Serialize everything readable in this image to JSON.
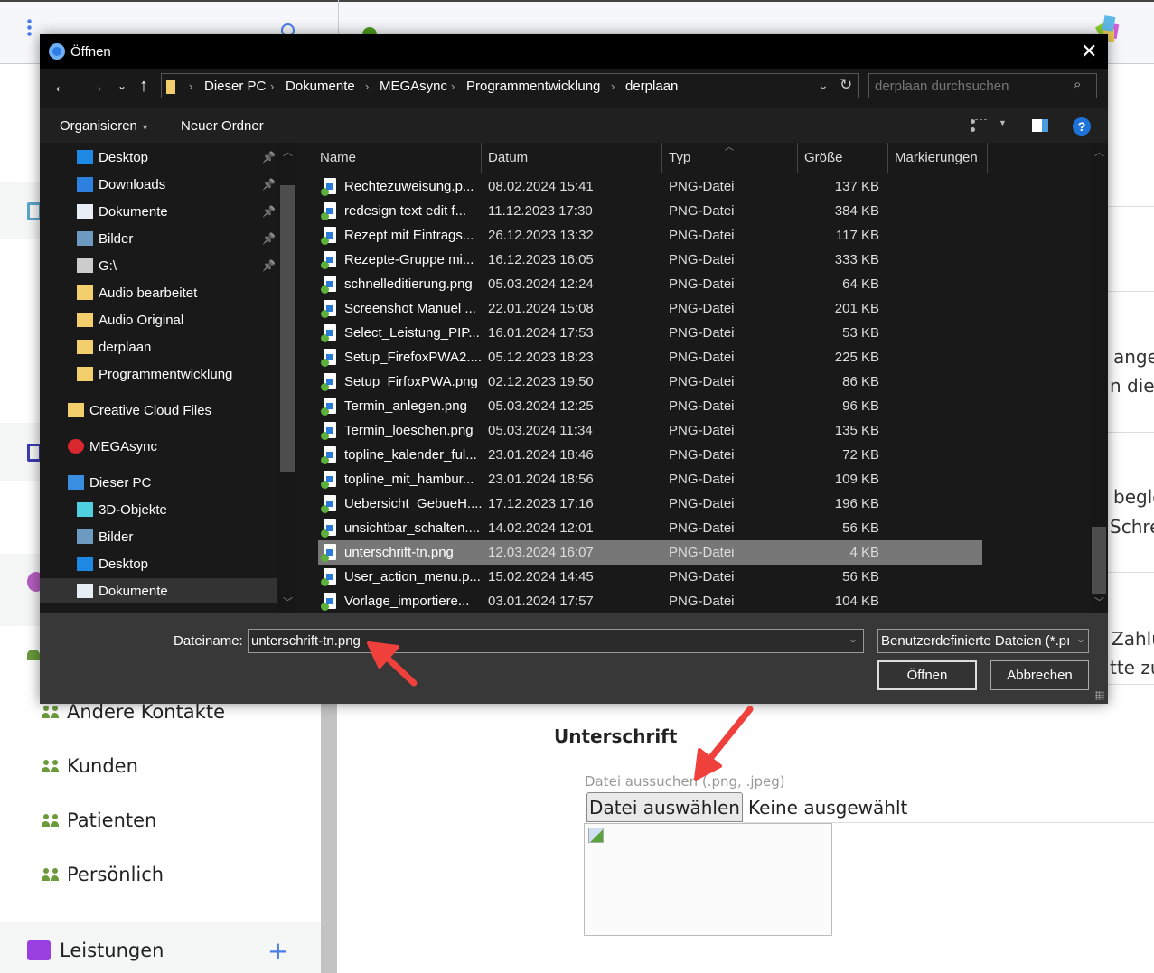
{
  "background": {
    "sidebar": {
      "groups": [
        "Andere Kontakte",
        "Kunden",
        "Patienten",
        "Persönlich"
      ],
      "section": {
        "label": "Leistungen",
        "add_icon": "plus-icon"
      }
    },
    "content": {
      "right_snippets": [
        "ange",
        "n dies",
        "begle",
        "Schre",
        "Zahlu",
        "tte zu"
      ],
      "signature": {
        "heading": "Unterschrift",
        "file_label": "Datei aussuchen (.png, .jpeg)",
        "choose_button": "Datei auswählen",
        "no_file": "Keine ausgewählt"
      }
    }
  },
  "dialog": {
    "title": "Öffnen",
    "breadcrumb": [
      "Dieser PC",
      "Dokumente",
      "MEGAsync",
      "Programmentwicklung",
      "derplaan"
    ],
    "search_placeholder": "derplaan durchsuchen",
    "toolbar": {
      "organize": "Organisieren",
      "new_folder": "Neuer Ordner"
    },
    "nav": [
      {
        "label": "Desktop",
        "icon": "desktop-icon",
        "pinned": true
      },
      {
        "label": "Downloads",
        "icon": "download-icon",
        "pinned": true
      },
      {
        "label": "Dokumente",
        "icon": "documents-icon",
        "pinned": true
      },
      {
        "label": "Bilder",
        "icon": "pictures-icon",
        "pinned": true
      },
      {
        "label": "G:\\",
        "icon": "drive-icon",
        "pinned": true
      },
      {
        "label": "Audio bearbeitet",
        "icon": "folder-icon"
      },
      {
        "label": "Audio Original",
        "icon": "folder-icon"
      },
      {
        "label": "derplaan",
        "icon": "folder-synced-icon"
      },
      {
        "label": "Programmentwicklung",
        "icon": "folder-synced-icon"
      },
      {
        "label": "Creative Cloud Files",
        "icon": "creative-cloud-folder-icon"
      },
      {
        "label": "MEGAsync",
        "icon": "mega-icon"
      },
      {
        "label": "Dieser PC",
        "icon": "computer-icon"
      },
      {
        "label": "3D-Objekte",
        "icon": "3d-objects-icon"
      },
      {
        "label": "Bilder",
        "icon": "pictures-icon"
      },
      {
        "label": "Desktop",
        "icon": "desktop-icon"
      },
      {
        "label": "Dokumente",
        "icon": "documents-icon",
        "selected": true
      }
    ],
    "columns": [
      "Name",
      "Datum",
      "Typ",
      "Größe",
      "Markierungen"
    ],
    "files": [
      [
        "Rechtezuweisung.p...",
        "08.02.2024 15:41",
        "PNG-Datei",
        "137 KB"
      ],
      [
        "redesign text edit f...",
        "11.12.2023 17:30",
        "PNG-Datei",
        "384 KB"
      ],
      [
        "Rezept mit Eintrags...",
        "26.12.2023 13:32",
        "PNG-Datei",
        "117 KB"
      ],
      [
        "Rezepte-Gruppe mi...",
        "16.12.2023 16:05",
        "PNG-Datei",
        "333 KB"
      ],
      [
        "schnelleditierung.png",
        "05.03.2024 12:24",
        "PNG-Datei",
        "64 KB"
      ],
      [
        "Screenshot Manuel ...",
        "22.01.2024 15:08",
        "PNG-Datei",
        "201 KB"
      ],
      [
        "Select_Leistung_PIP...",
        "16.01.2024 17:53",
        "PNG-Datei",
        "53 KB"
      ],
      [
        "Setup_FirefoxPWA2....",
        "05.12.2023 18:23",
        "PNG-Datei",
        "225 KB"
      ],
      [
        "Setup_FirfoxPWA.png",
        "02.12.2023 19:50",
        "PNG-Datei",
        "86 KB"
      ],
      [
        "Termin_anlegen.png",
        "05.03.2024 12:25",
        "PNG-Datei",
        "96 KB"
      ],
      [
        "Termin_loeschen.png",
        "05.03.2024 11:34",
        "PNG-Datei",
        "135 KB"
      ],
      [
        "topline_kalender_ful...",
        "23.01.2024 18:46",
        "PNG-Datei",
        "72 KB"
      ],
      [
        "topline_mit_hambur...",
        "23.01.2024 18:56",
        "PNG-Datei",
        "109 KB"
      ],
      [
        "Uebersicht_GebueH....",
        "17.12.2023 17:16",
        "PNG-Datei",
        "196 KB"
      ],
      [
        "unsichtbar_schalten....",
        "14.02.2024 12:01",
        "PNG-Datei",
        "56 KB"
      ],
      [
        "unterschrift-tn.png",
        "12.03.2024 16:07",
        "PNG-Datei",
        "4 KB"
      ],
      [
        "User_action_menu.p...",
        "15.02.2024 14:45",
        "PNG-Datei",
        "56 KB"
      ],
      [
        "Vorlage_importiere...",
        "03.01.2024 17:57",
        "PNG-Datei",
        "104 KB"
      ]
    ],
    "selected_index": 15,
    "filename_label": "Dateiname:",
    "filename_value": "unterschrift-tn.png",
    "filter": "Benutzerdefinierte Dateien (*.pı",
    "open_button": "Öffnen",
    "cancel_button": "Abbrechen"
  },
  "colors": {
    "annotation_arrow": "#f0403c",
    "selection": "#777777",
    "help": "#1e73d8"
  }
}
